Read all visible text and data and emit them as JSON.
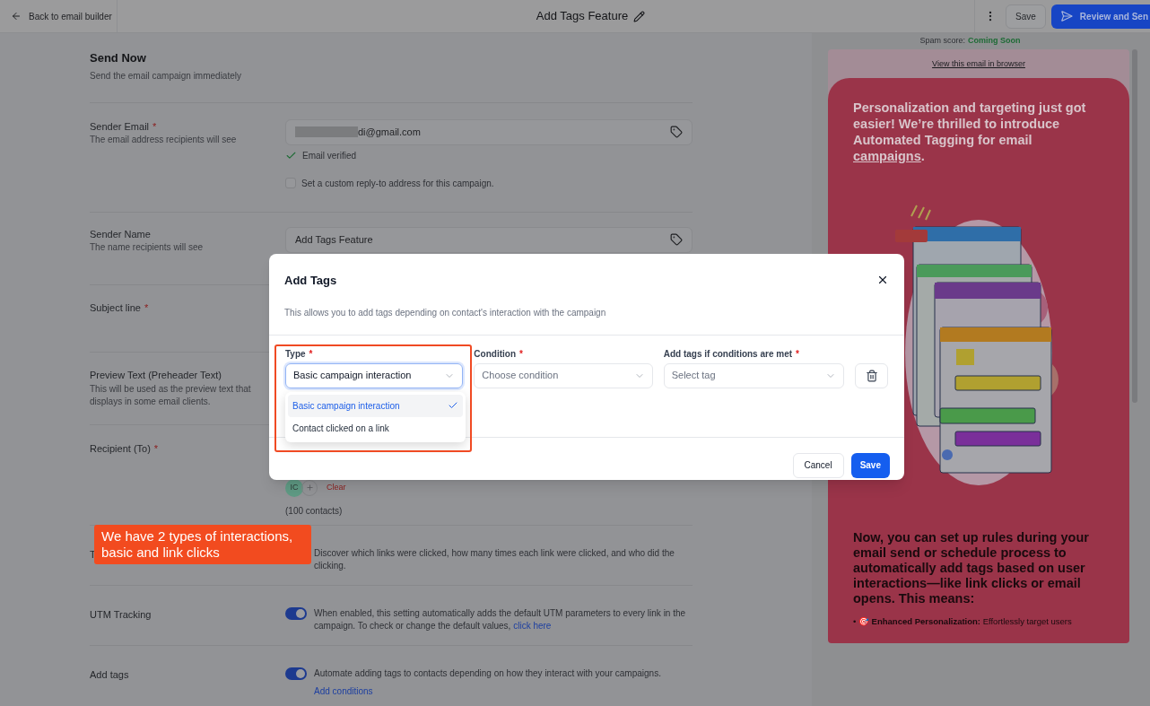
{
  "header": {
    "back_label": "Back to email builder",
    "title": "Add Tags Feature",
    "save_label": "Save",
    "send_label": "Review and Sen"
  },
  "page": {
    "title": "Send Now",
    "subtitle": "Send the email campaign immediately",
    "rows": [
      {
        "kind": "email",
        "label": "Sender Email",
        "required_mark": "*",
        "description": "The email address recipients will see",
        "value": "di@gmail.com",
        "verified_label": "Email verified",
        "checkbox": {
          "label": "Set a custom reply-to address for this campaign.",
          "checked": false
        }
      },
      {
        "kind": "text_field",
        "label": "Sender Name",
        "description": "The name recipients will see",
        "value": "Add Tags Feature"
      },
      {
        "kind": "plain",
        "label": "Subject line",
        "required_mark": "*"
      },
      {
        "kind": "plain",
        "label": "Preview Text (Preheader Text)",
        "description": "This will be used as the preview text that displays in some email clients."
      },
      {
        "kind": "recipient",
        "label": "Recipient (To)",
        "required_mark": "*",
        "avatar": "IC",
        "clear_label": "Clear",
        "count": "(100 contacts)"
      },
      {
        "kind": "toggle",
        "label": "T",
        "description": "Discover which links were clicked, how many times each link were clicked, and who did the clicking."
      },
      {
        "kind": "toggle",
        "label": "UTM Tracking",
        "on": true,
        "description": "When enabled, this setting automatically adds the default UTM parameters to every link in the campaign. To check or change the default values,",
        "inline_link": "click here"
      },
      {
        "kind": "toggle",
        "label": "Add tags",
        "on": true,
        "description": "Automate adding tags to contacts depending on how they interact with your campaigns.",
        "link_below": "Add conditions"
      }
    ]
  },
  "preview": {
    "spam_label": "Spam score:",
    "spam_value": "Coming Soon",
    "browser_link": "View this email in browser",
    "headline": "Personalization and targeting just got easier! We’re thrilled to introduce Automated Tagging for email",
    "headline_link": "campaigns",
    "headline_end": ".",
    "body_heading": "Now, you can set up rules during your email send or schedule process to automatically add tags based on user interactions—like link clicks or email opens. This means:",
    "bullet": "• 🎯 **Enhanced Personalization:** Effortlessly target users"
  },
  "modal": {
    "title": "Add Tags",
    "description": "This allows you to add tags depending on contact's interaction with the campaign",
    "fields": [
      {
        "kind": "type",
        "label": "Type",
        "required_mark": "*",
        "value": "Basic campaign interaction",
        "open": true,
        "options": [
          {
            "label": "Basic campaign interaction",
            "selected": true
          },
          {
            "label": "Contact clicked on a link",
            "selected": false
          }
        ]
      },
      {
        "kind": "select",
        "label": "Condition",
        "required_mark": "*",
        "placeholder": "Choose condition"
      },
      {
        "kind": "select",
        "label": "Add tags if conditions are met",
        "required_mark": "*",
        "placeholder": "Select tag"
      }
    ],
    "cancel_label": "Cancel",
    "save_label": "Save"
  },
  "callout": {
    "text": "We have 2 types of interactions, basic and link clicks"
  }
}
